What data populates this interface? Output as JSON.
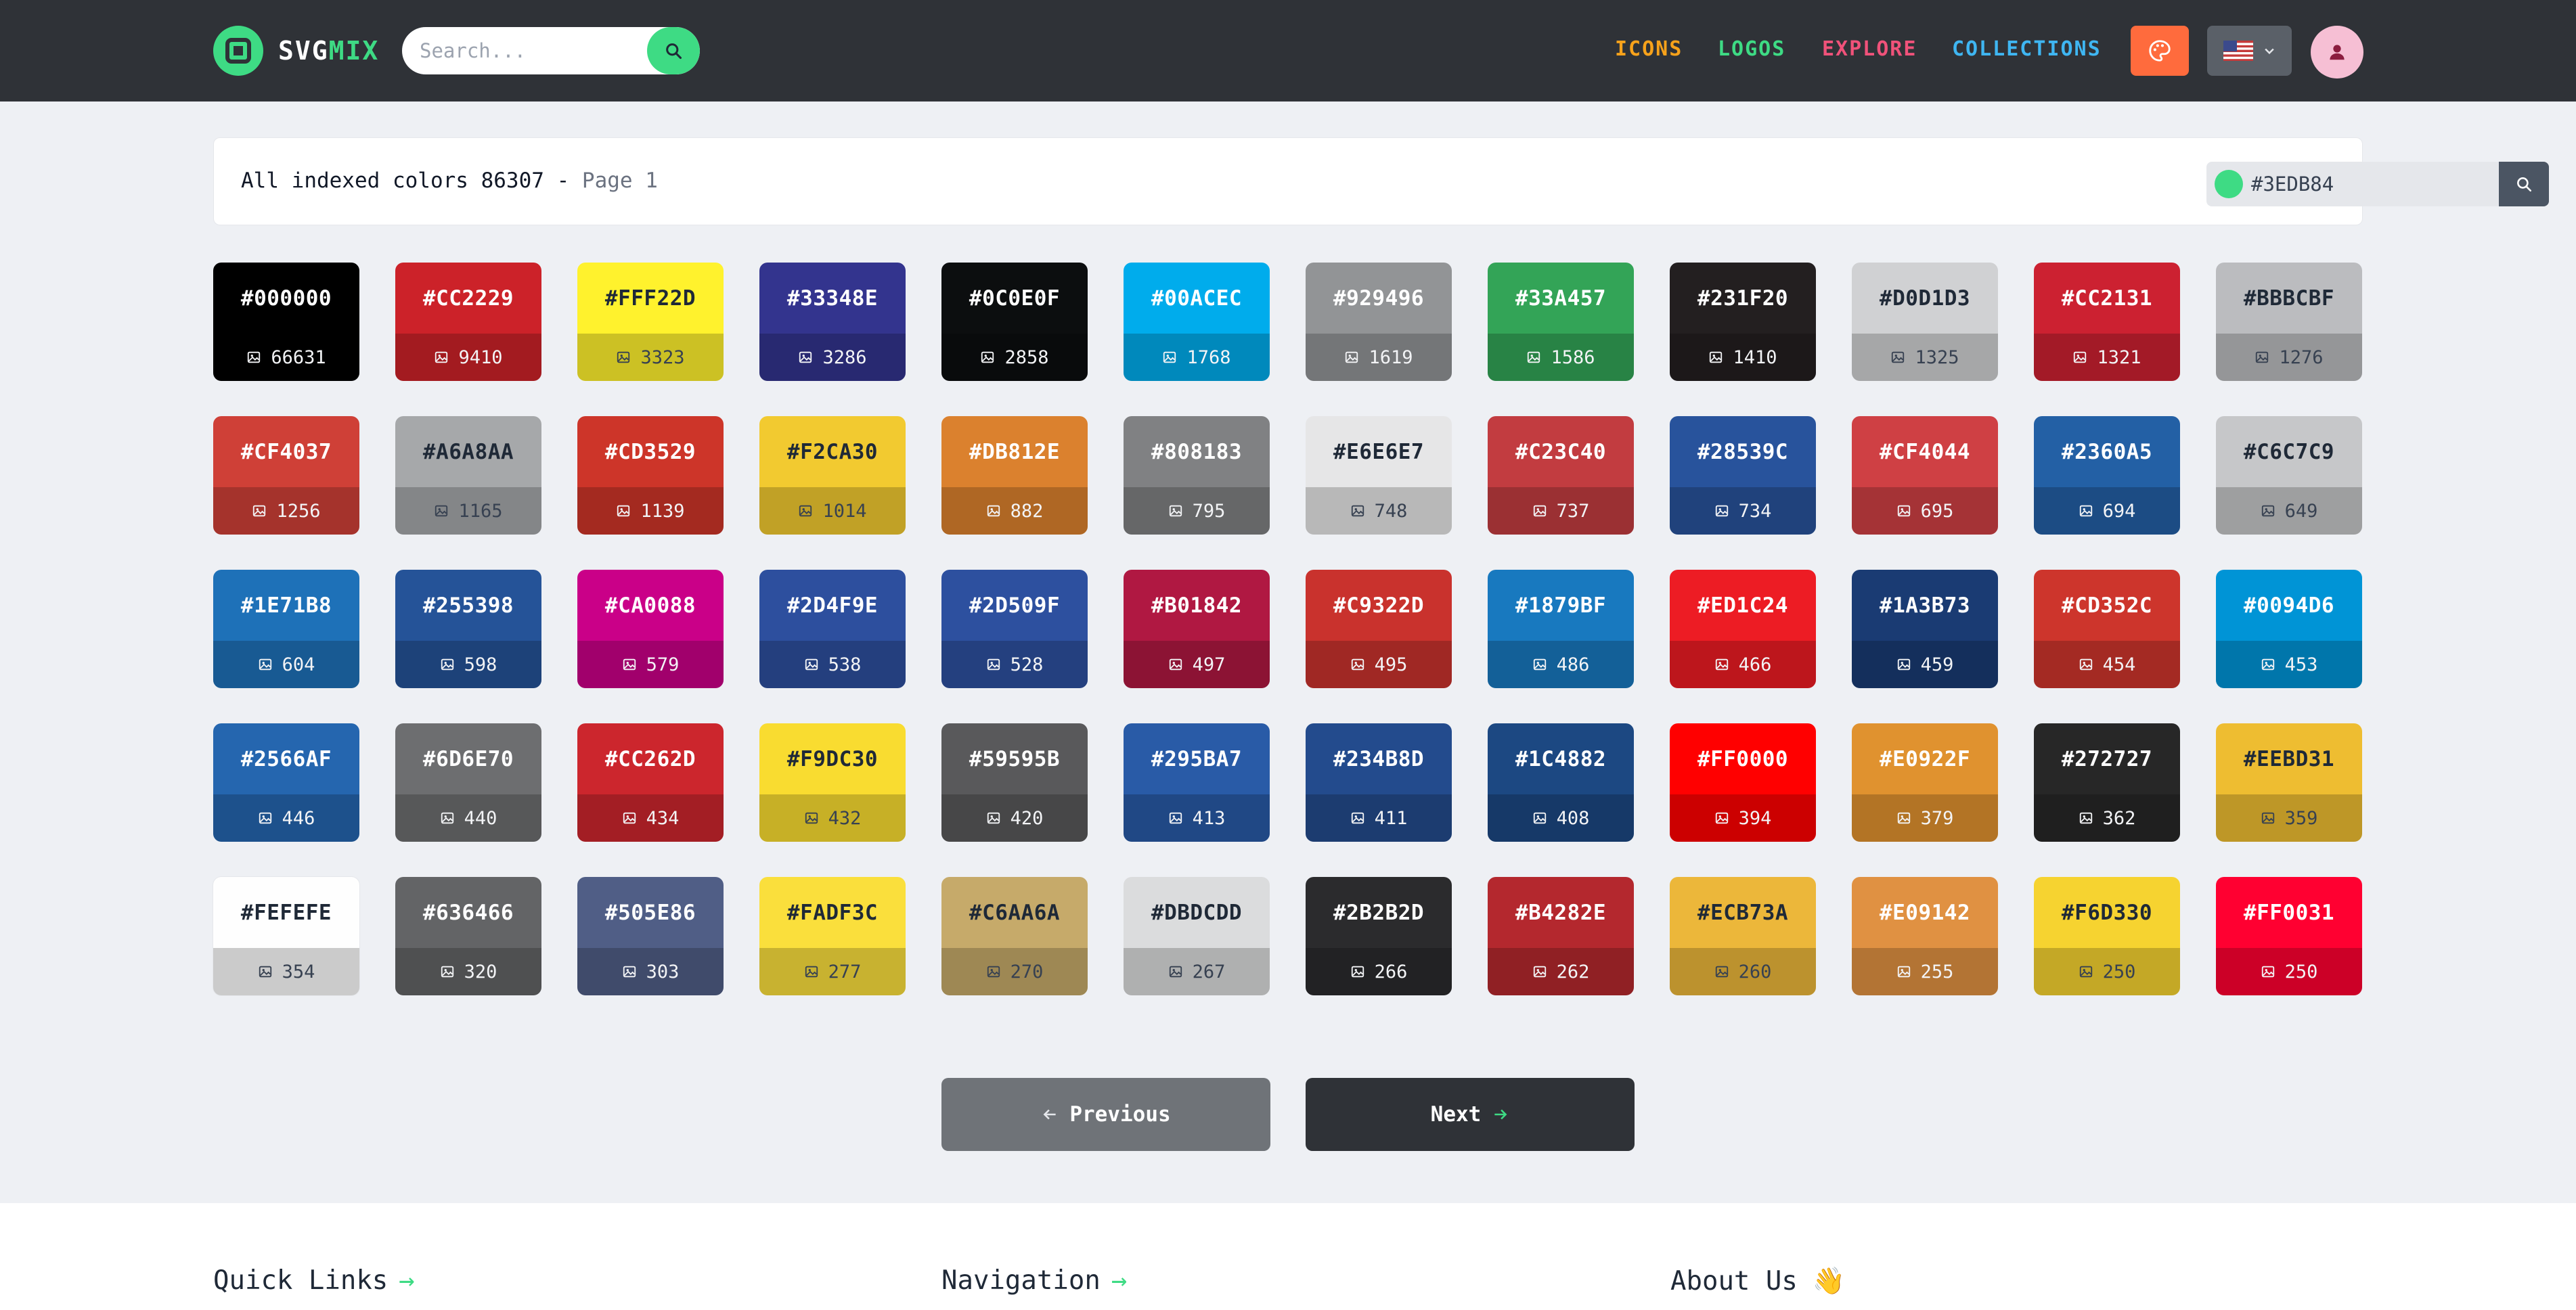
{
  "header": {
    "logo_text": "SVG",
    "logo_text_accent": "MIX",
    "search_placeholder": "Search...",
    "nav": [
      {
        "label": "ICONS",
        "color": "#f7a21b"
      },
      {
        "label": "LOGOS",
        "color": "#3edb84"
      },
      {
        "label": "EXPLORE",
        "color": "#f0527a"
      },
      {
        "label": "COLLECTIONS",
        "color": "#3fb6f2"
      }
    ],
    "palette_button_color": "#ff6b3d",
    "language_icon": "us-flag-icon"
  },
  "panel": {
    "title_prefix": "All indexed colors 86307 - ",
    "title_page": "Page 1",
    "color_input_value": "#3EDB84",
    "color_dot": "#3EDB84"
  },
  "colors": [
    {
      "hex": "#000000",
      "count": "66631"
    },
    {
      "hex": "#CC2229",
      "count": "9410"
    },
    {
      "hex": "#FFF22D",
      "count": "3323"
    },
    {
      "hex": "#33348E",
      "count": "3286"
    },
    {
      "hex": "#0C0E0F",
      "count": "2858"
    },
    {
      "hex": "#00ACEC",
      "count": "1768"
    },
    {
      "hex": "#929496",
      "count": "1619"
    },
    {
      "hex": "#33A457",
      "count": "1586"
    },
    {
      "hex": "#231F20",
      "count": "1410"
    },
    {
      "hex": "#D0D1D3",
      "count": "1325"
    },
    {
      "hex": "#CC2131",
      "count": "1321"
    },
    {
      "hex": "#BBBCBF",
      "count": "1276"
    },
    {
      "hex": "#CF4037",
      "count": "1256"
    },
    {
      "hex": "#A6A8AA",
      "count": "1165"
    },
    {
      "hex": "#CD3529",
      "count": "1139"
    },
    {
      "hex": "#F2CA30",
      "count": "1014"
    },
    {
      "hex": "#DB812E",
      "count": "882"
    },
    {
      "hex": "#808183",
      "count": "795"
    },
    {
      "hex": "#E6E6E7",
      "count": "748"
    },
    {
      "hex": "#C23C40",
      "count": "737"
    },
    {
      "hex": "#28539C",
      "count": "734"
    },
    {
      "hex": "#CF4044",
      "count": "695"
    },
    {
      "hex": "#2360A5",
      "count": "694"
    },
    {
      "hex": "#C6C7C9",
      "count": "649"
    },
    {
      "hex": "#1E71B8",
      "count": "604"
    },
    {
      "hex": "#255398",
      "count": "598"
    },
    {
      "hex": "#CA0088",
      "count": "579"
    },
    {
      "hex": "#2D4F9E",
      "count": "538"
    },
    {
      "hex": "#2D509F",
      "count": "528"
    },
    {
      "hex": "#B01842",
      "count": "497"
    },
    {
      "hex": "#C9322D",
      "count": "495"
    },
    {
      "hex": "#1879BF",
      "count": "486"
    },
    {
      "hex": "#ED1C24",
      "count": "466"
    },
    {
      "hex": "#1A3B73",
      "count": "459"
    },
    {
      "hex": "#CD352C",
      "count": "454"
    },
    {
      "hex": "#0094D6",
      "count": "453"
    },
    {
      "hex": "#2566AF",
      "count": "446"
    },
    {
      "hex": "#6D6E70",
      "count": "440"
    },
    {
      "hex": "#CC262D",
      "count": "434"
    },
    {
      "hex": "#F9DC30",
      "count": "432"
    },
    {
      "hex": "#59595B",
      "count": "420"
    },
    {
      "hex": "#295BA7",
      "count": "413"
    },
    {
      "hex": "#234B8D",
      "count": "411"
    },
    {
      "hex": "#1C4882",
      "count": "408"
    },
    {
      "hex": "#FF0000",
      "count": "394"
    },
    {
      "hex": "#E0922F",
      "count": "379"
    },
    {
      "hex": "#272727",
      "count": "362"
    },
    {
      "hex": "#EEBD31",
      "count": "359"
    },
    {
      "hex": "#FEFEFE",
      "count": "354"
    },
    {
      "hex": "#636466",
      "count": "320"
    },
    {
      "hex": "#505E86",
      "count": "303"
    },
    {
      "hex": "#FADF3C",
      "count": "277"
    },
    {
      "hex": "#C6AA6A",
      "count": "270"
    },
    {
      "hex": "#DBDCDD",
      "count": "267"
    },
    {
      "hex": "#2B2B2D",
      "count": "266"
    },
    {
      "hex": "#B4282E",
      "count": "262"
    },
    {
      "hex": "#ECB73A",
      "count": "260"
    },
    {
      "hex": "#E09142",
      "count": "255"
    },
    {
      "hex": "#F6D330",
      "count": "250"
    },
    {
      "hex": "#FF0031",
      "count": "250"
    }
  ],
  "pagination": {
    "previous_label": "Previous",
    "next_label": "Next"
  },
  "footer": {
    "quick_links": "Quick Links",
    "navigation": "Navigation",
    "about_us": "About Us",
    "about_icon": "👋"
  }
}
